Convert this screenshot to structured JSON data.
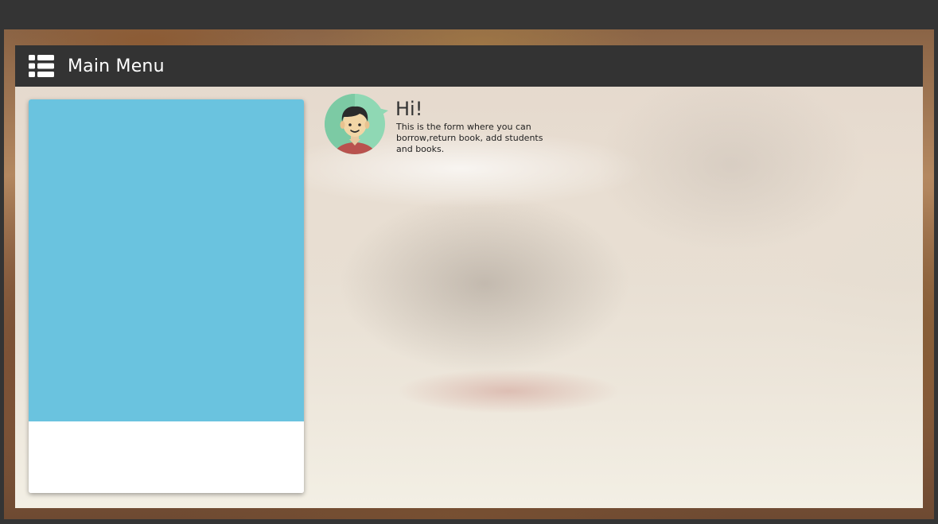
{
  "header": {
    "title": "Main Menu",
    "menu_icon": "list-menu-icon"
  },
  "card": {
    "media_color": "#6ac3df"
  },
  "welcome": {
    "greeting": "Hi!",
    "message": "This is the form where you can borrow,return book, add students and books.",
    "avatar_icon": "user-avatar-icon"
  },
  "colors": {
    "header_bg": "#333333",
    "header_text": "#ffffff",
    "card_media": "#6ac3df",
    "avatar_bg": "#8fd8b4"
  }
}
